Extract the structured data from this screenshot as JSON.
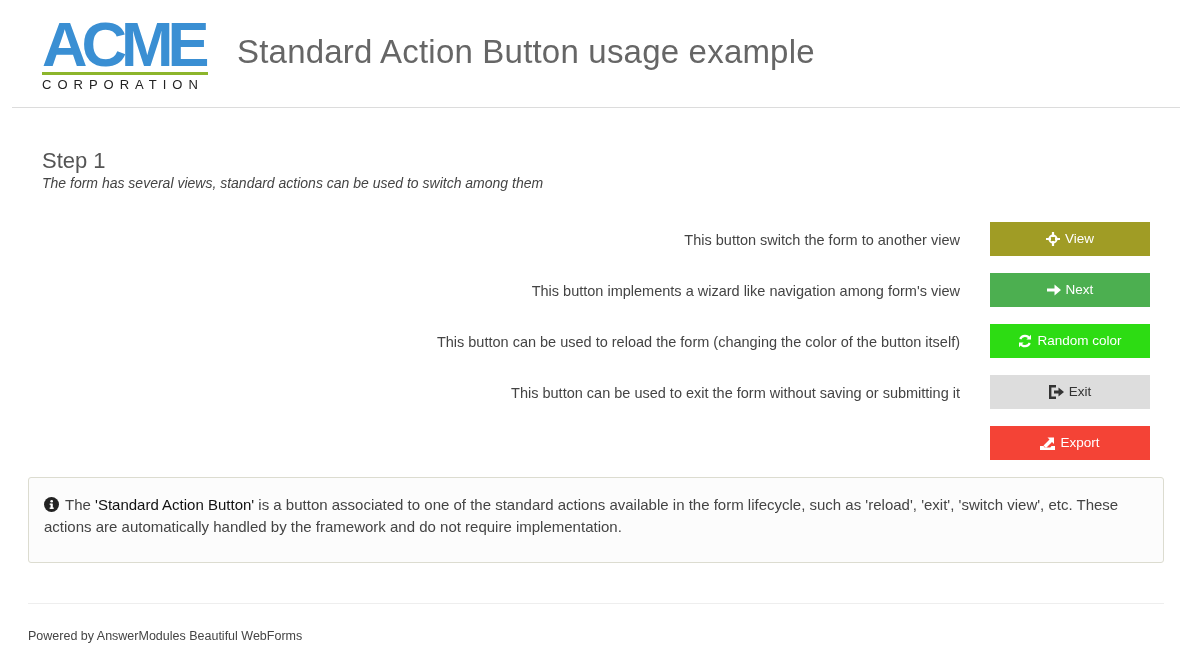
{
  "header": {
    "logo": {
      "wordmark": "ACME",
      "tagline": "CORPORATION"
    },
    "title": "Standard Action Button usage example"
  },
  "section": {
    "title": "Step 1",
    "subtitle": "The form has several views, standard actions can be used to switch among them"
  },
  "actions": [
    {
      "description": "This button switch the form to another view",
      "button": {
        "label": "View",
        "kind": "view",
        "color": "#a09c25"
      }
    },
    {
      "description": "This button implements a wizard like navigation among form's view",
      "button": {
        "label": "Next",
        "kind": "next",
        "color": "#4caf50"
      }
    },
    {
      "description": "This button can be used to reload the form (changing the color of the button itself)",
      "button": {
        "label": "Random color",
        "kind": "reload",
        "color": "#2ddc13"
      }
    },
    {
      "description": "This button can be used to exit the form without saving or submitting it",
      "button": {
        "label": "Exit",
        "kind": "exit",
        "color": "#dddddd"
      }
    },
    {
      "button": {
        "label": "Export",
        "kind": "export",
        "color": "#f44336"
      }
    }
  ],
  "info": {
    "text": "The **'Standard Action Button'** is a button associated to one of the standard actions available in the form lifecycle, such as 'reload', 'exit', 'switch view', etc. These actions are automatically handled by the framework and do not require implementation."
  },
  "footer": {
    "text": "Powered by AnswerModules Beautiful WebForms"
  }
}
